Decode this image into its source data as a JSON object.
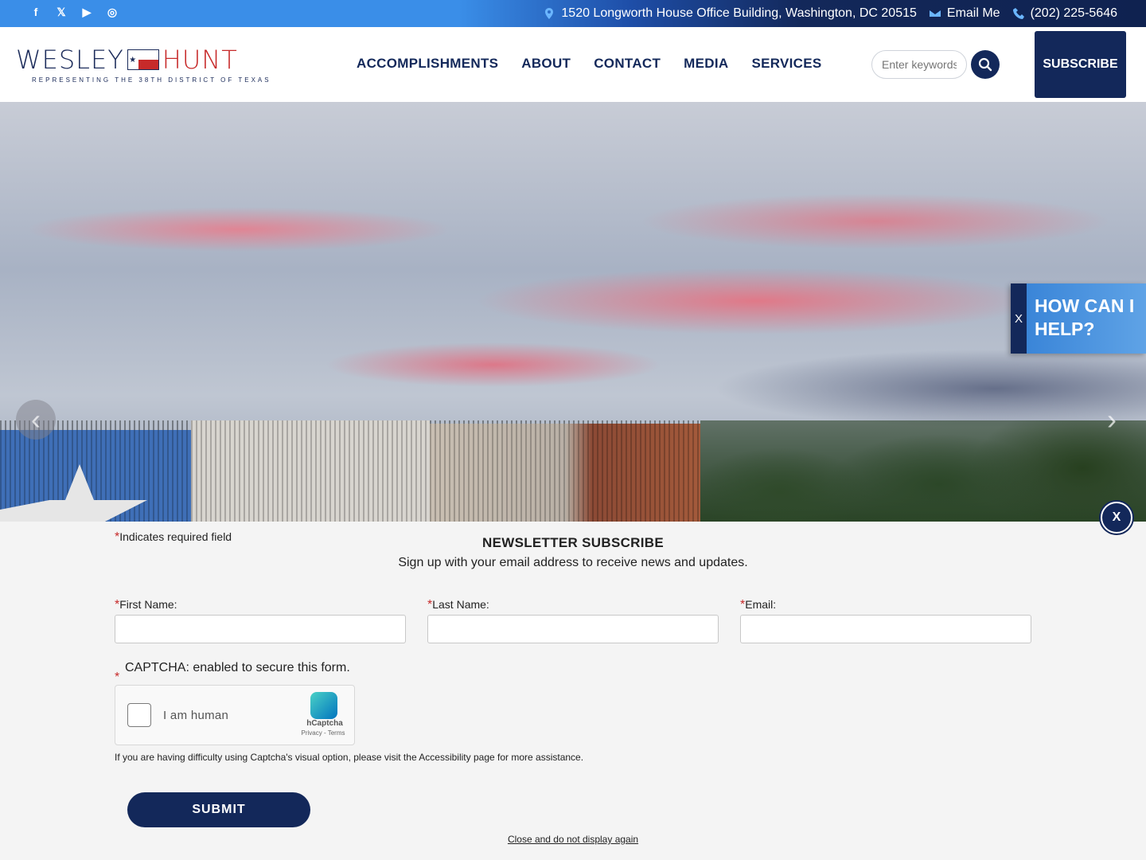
{
  "topbar": {
    "socials": [
      {
        "icon": "facebook-icon",
        "glyph": "f"
      },
      {
        "icon": "x-twitter-icon",
        "glyph": "𝕏"
      },
      {
        "icon": "youtube-icon",
        "glyph": "▶"
      },
      {
        "icon": "instagram-icon",
        "glyph": "◎"
      }
    ],
    "address": "1520 Longworth House Office Building, Washington, DC 20515",
    "email_label": "Email Me",
    "phone": "(202) 225-5646"
  },
  "header": {
    "logo_first": "WESLEY",
    "logo_last": "HUNT",
    "logo_tagline": "REPRESENTING THE 38TH DISTRICT OF TEXAS",
    "nav": [
      "ACCOMPLISHMENTS",
      "ABOUT",
      "CONTACT",
      "MEDIA",
      "SERVICES"
    ],
    "search_placeholder": "Enter keywords",
    "subscribe_label": "SUBSCRIBE"
  },
  "hero": {
    "prev_glyph": "‹",
    "next_glyph": "›"
  },
  "help_widget": {
    "close_label": "X",
    "text": "HOW CAN I HELP?"
  },
  "newsletter": {
    "close_label": "X",
    "required_note": "Indicates required field",
    "required_mark": "*",
    "title": "NEWSLETTER SUBSCRIBE",
    "subtitle": "Sign up with your email address to receive news and updates.",
    "fields": [
      {
        "label": "First Name:",
        "value": ""
      },
      {
        "label": "Last Name:",
        "value": ""
      },
      {
        "label": "Email:",
        "value": ""
      }
    ],
    "captcha_label": "CAPTCHA: enabled to secure this form.",
    "captcha_checkbox_label": "I am human",
    "captcha_brand": "hCaptcha",
    "captcha_links": "Privacy - Terms",
    "accessibility_note": "If you are having difficulty using Captcha's visual option, please visit the Accessibility page for more assistance.",
    "submit_label": "SUBMIT",
    "close_forever_label": "Close and do not display again"
  },
  "colors": {
    "navy": "#13285a",
    "brand_red": "#c72a2a",
    "accent_blue": "#3a8ee8"
  }
}
